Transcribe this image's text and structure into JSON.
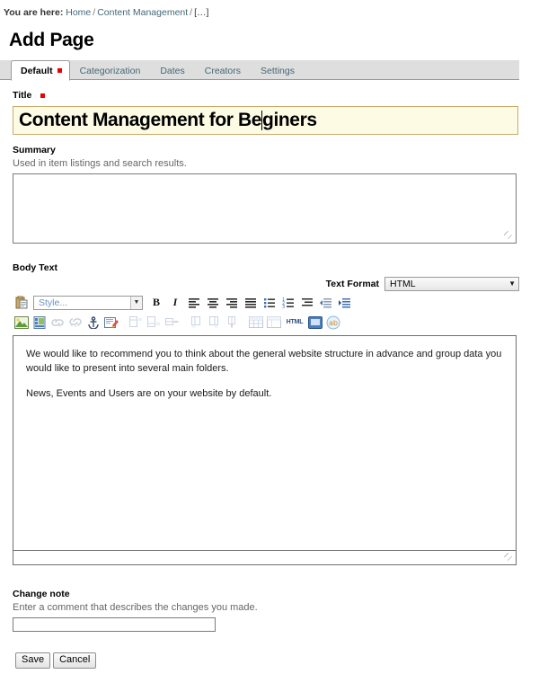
{
  "breadcrumb": {
    "label": "You are here:",
    "items": [
      {
        "text": "Home",
        "type": "link"
      },
      {
        "text": "Content Management",
        "type": "link"
      },
      {
        "text": "[…]",
        "type": "current"
      }
    ],
    "separator": "/"
  },
  "page": {
    "title": "Add Page"
  },
  "tabs": [
    {
      "label": "Default",
      "active": true,
      "required": true
    },
    {
      "label": "Categorization",
      "active": false,
      "required": false
    },
    {
      "label": "Dates",
      "active": false,
      "required": false
    },
    {
      "label": "Creators",
      "active": false,
      "required": false
    },
    {
      "label": "Settings",
      "active": false,
      "required": false
    }
  ],
  "fields": {
    "title": {
      "label": "Title",
      "required": true,
      "value_before_caret": "Content Management for Be",
      "value_after_caret": "giners",
      "value": "Content Management for Beginners",
      "focused": true
    },
    "summary": {
      "label": "Summary",
      "help": "Used in item listings and search results.",
      "value": ""
    },
    "body": {
      "label": "Body Text",
      "text_format_label": "Text Format",
      "text_format_value": "HTML",
      "text_format_options": [
        "HTML"
      ],
      "style_placeholder": "Style...",
      "paragraphs": [
        "We would like to recommend you to think about the general website structure in advance and group data you would like to present into several main folders.",
        "News, Events and Users are on your website by default."
      ]
    },
    "change_note": {
      "label": "Change note",
      "help": "Enter a comment that describes the changes you made.",
      "value": ""
    }
  },
  "toolbar": {
    "row1": [
      {
        "name": "paste-from-word-icon",
        "glyph": "paste"
      },
      {
        "name": "style-select",
        "glyph": "select"
      },
      {
        "name": "bold-button",
        "glyph": "B"
      },
      {
        "name": "italic-button",
        "glyph": "I"
      },
      {
        "name": "align-left-button",
        "glyph": "align-left"
      },
      {
        "name": "align-center-button",
        "glyph": "align-center"
      },
      {
        "name": "align-right-button",
        "glyph": "align-right"
      },
      {
        "name": "align-justify-button",
        "glyph": "align-justify"
      },
      {
        "name": "bulleted-list-button",
        "glyph": "ul"
      },
      {
        "name": "numbered-list-button",
        "glyph": "ol"
      },
      {
        "name": "definition-list-button",
        "glyph": "dl"
      },
      {
        "name": "outdent-button",
        "glyph": "outdent"
      },
      {
        "name": "indent-button",
        "glyph": "indent"
      }
    ],
    "row2": [
      {
        "name": "insert-image-icon",
        "glyph": "image"
      },
      {
        "name": "insert-media-icon",
        "glyph": "media"
      },
      {
        "name": "insert-link-icon",
        "glyph": "link",
        "disabled": true
      },
      {
        "name": "remove-link-icon",
        "glyph": "unlink",
        "disabled": true
      },
      {
        "name": "insert-anchor-icon",
        "glyph": "anchor"
      },
      {
        "name": "edit-form-icon",
        "glyph": "form"
      },
      {
        "name": "insert-row-above-icon",
        "glyph": "row-above",
        "disabled": true
      },
      {
        "name": "insert-row-below-icon",
        "glyph": "row-below",
        "disabled": true
      },
      {
        "name": "delete-row-icon",
        "glyph": "row-delete",
        "disabled": true
      },
      {
        "name": "insert-column-left-icon",
        "glyph": "col-left",
        "disabled": true
      },
      {
        "name": "insert-column-right-icon",
        "glyph": "col-right",
        "disabled": true
      },
      {
        "name": "delete-column-icon",
        "glyph": "col-delete",
        "disabled": true
      },
      {
        "name": "insert-table-icon",
        "glyph": "table",
        "disabled": true
      },
      {
        "name": "table-properties-icon",
        "glyph": "table-props",
        "disabled": true
      },
      {
        "name": "html-source-icon",
        "glyph": "HTML"
      },
      {
        "name": "fullscreen-icon",
        "glyph": "fullscreen"
      },
      {
        "name": "spellcheck-icon",
        "glyph": "spell"
      }
    ]
  },
  "actions": {
    "save_label": "Save",
    "cancel_label": "Cancel"
  },
  "colors": {
    "link": "#436976",
    "required_marker": "#ee0000",
    "focused_field_bg": "#fdfbe4",
    "focused_field_border": "#c9ab6b",
    "tabbar_bg": "#dedede"
  }
}
